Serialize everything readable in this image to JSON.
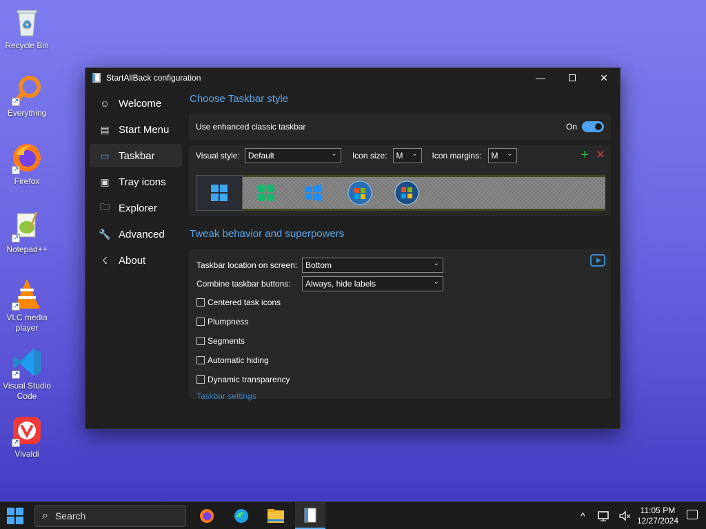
{
  "desktop": {
    "icons": [
      {
        "label": "Recycle Bin",
        "icon": "recycle-bin-icon"
      },
      {
        "label": "Everything",
        "icon": "everything-search-icon"
      },
      {
        "label": "Firefox",
        "icon": "firefox-icon"
      },
      {
        "label": "Notepad++",
        "icon": "notepad-plus-plus-icon"
      },
      {
        "label": "VLC media player",
        "icon": "vlc-icon"
      },
      {
        "label": "Visual Studio Code",
        "icon": "vscode-icon"
      },
      {
        "label": "Vivaldi",
        "icon": "vivaldi-icon"
      }
    ]
  },
  "window": {
    "title": "StartAllBack configuration",
    "controls": {
      "minimize": "—",
      "close": "✕"
    }
  },
  "sidebar": {
    "items": [
      {
        "label": "Welcome",
        "icon": "smiley-icon",
        "glyph": "☺"
      },
      {
        "label": "Start Menu",
        "icon": "start-menu-icon",
        "glyph": "▤"
      },
      {
        "label": "Taskbar",
        "icon": "taskbar-icon",
        "glyph": "▭"
      },
      {
        "label": "Tray icons",
        "icon": "tray-icons-icon",
        "glyph": "▣"
      },
      {
        "label": "Explorer",
        "icon": "folder-icon",
        "glyph": "🗀"
      },
      {
        "label": "Advanced",
        "icon": "wrench-icon",
        "glyph": "🔧"
      },
      {
        "label": "About",
        "icon": "about-icon",
        "glyph": "☇"
      }
    ],
    "active": "Taskbar"
  },
  "taskbar_style": {
    "section_title": "Choose Taskbar style",
    "enhanced_label": "Use enhanced classic taskbar",
    "toggle_state": "On",
    "visual_style_label": "Visual style:",
    "visual_style_value": "Default",
    "icon_size_label": "Icon size:",
    "icon_size_value": "M",
    "icon_margins_label": "Icon margins:",
    "icon_margins_value": "M",
    "add_glyph": "+",
    "remove_glyph": "✕"
  },
  "tweaks": {
    "section_title": "Tweak behavior and superpowers",
    "location_label": "Taskbar location on screen:",
    "location_value": "Bottom",
    "combine_label": "Combine taskbar buttons:",
    "combine_value": "Always, hide labels",
    "options": [
      {
        "label": "Centered task icons",
        "checked": false
      },
      {
        "label": "Plumpness",
        "checked": false
      },
      {
        "label": "Segments",
        "checked": false
      },
      {
        "label": "Automatic hiding",
        "checked": false
      },
      {
        "label": "Dynamic transparency",
        "checked": false
      }
    ],
    "settings_link": "Taskbar settings"
  },
  "taskbar": {
    "search_placeholder": "Search",
    "time": "11:05 PM",
    "date": "12/27/2024",
    "accent": "#5ab0f5"
  }
}
